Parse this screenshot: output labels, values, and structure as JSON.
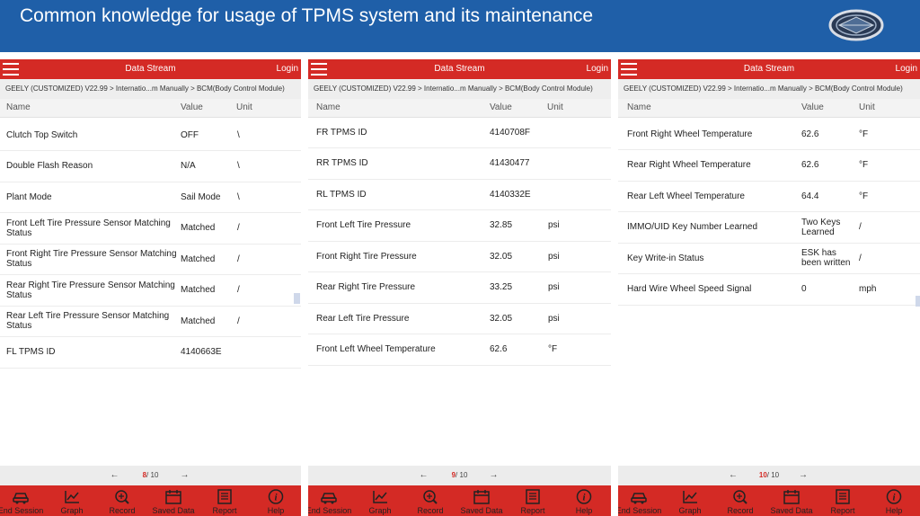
{
  "banner": {
    "title": "Common knowledge for usage of TPMS system and its maintenance",
    "logo_icon": "geely-logo-icon"
  },
  "app": {
    "title": "Data Stream",
    "login": "Login",
    "breadcrumb": "GEELY (CUSTOMIZED) V22.99 > Internatio...m Manually > BCM(Body Control Module)",
    "columns": {
      "name": "Name",
      "value": "Value",
      "unit": "Unit"
    },
    "toolbar": [
      "End Session",
      "Graph",
      "Record",
      "Saved Data",
      "Report",
      "Help"
    ],
    "colors": {
      "accent": "#d42a25",
      "banner": "#1f5fa8"
    }
  },
  "panels": [
    {
      "page_current": "8",
      "page_total": "/ 10",
      "rows": [
        {
          "name": "Clutch Top Switch",
          "value": "OFF",
          "unit": "\\"
        },
        {
          "name": "Double Flash Reason",
          "value": "N/A",
          "unit": "\\"
        },
        {
          "name": "Plant Mode",
          "value": "Sail Mode",
          "unit": "\\"
        },
        {
          "name": "Front Left Tire Pressure Sensor Matching Status",
          "value": "Matched",
          "unit": "/"
        },
        {
          "name": "Front Right Tire Pressure Sensor Matching Status",
          "value": "Matched",
          "unit": "/"
        },
        {
          "name": "Rear Right Tire Pressure Sensor Matching Status",
          "value": "Matched",
          "unit": "/"
        },
        {
          "name": "Rear Left Tire Pressure Sensor Matching Status",
          "value": "Matched",
          "unit": "/"
        },
        {
          "name": "FL TPMS ID",
          "value": "4140663E",
          "unit": ""
        }
      ]
    },
    {
      "page_current": "9",
      "page_total": "/ 10",
      "rows": [
        {
          "name": "FR TPMS ID",
          "value": "4140708F",
          "unit": ""
        },
        {
          "name": "RR TPMS ID",
          "value": "41430477",
          "unit": ""
        },
        {
          "name": "RL TPMS ID",
          "value": "4140332E",
          "unit": ""
        },
        {
          "name": "Front Left Tire Pressure",
          "value": "32.85",
          "unit": "psi"
        },
        {
          "name": "Front Right Tire Pressure",
          "value": "32.05",
          "unit": "psi"
        },
        {
          "name": "Rear Right Tire Pressure",
          "value": "33.25",
          "unit": "psi"
        },
        {
          "name": "Rear Left Tire Pressure",
          "value": "32.05",
          "unit": "psi"
        },
        {
          "name": "Front Left Wheel Temperature",
          "value": "62.6",
          "unit": "°F"
        }
      ]
    },
    {
      "page_current": "10",
      "page_total": "/ 10",
      "rows": [
        {
          "name": "Front Right Wheel Temperature",
          "value": "62.6",
          "unit": "°F"
        },
        {
          "name": "Rear Right Wheel Temperature",
          "value": "62.6",
          "unit": "°F"
        },
        {
          "name": "Rear Left Wheel Temperature",
          "value": "64.4",
          "unit": "°F"
        },
        {
          "name": "IMMO/UID Key Number Learned",
          "value": "Two Keys Learned",
          "unit": "/"
        },
        {
          "name": "Key Write-in Status",
          "value": "ESK has been written",
          "unit": "/"
        },
        {
          "name": "Hard Wire Wheel Speed Signal",
          "value": "0",
          "unit": "mph"
        }
      ]
    }
  ]
}
